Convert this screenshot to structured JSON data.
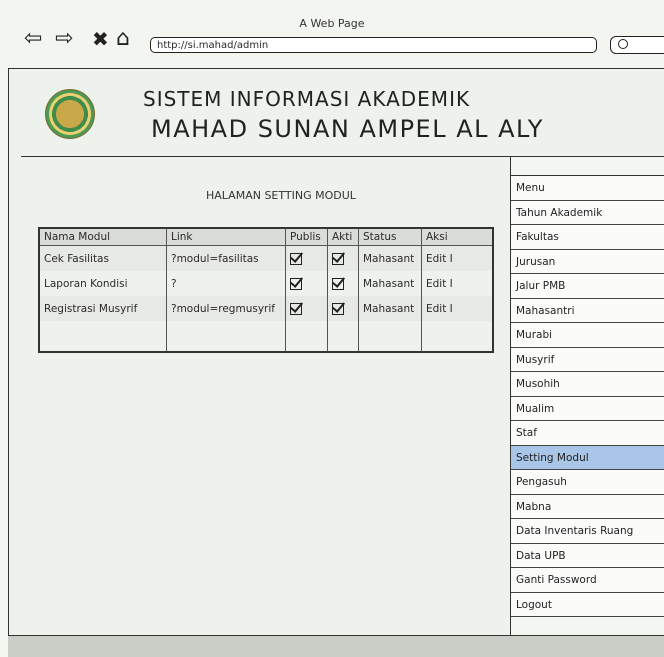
{
  "browser": {
    "window_title": "A Web Page",
    "url": "http://si.mahad/admin"
  },
  "header": {
    "title_line1": "SISTEM INFORMASI AKADEMIK",
    "title_line2": "MAHAD SUNAN AMPEL AL ALY"
  },
  "content": {
    "title": "HALAMAN SETTING MODUL",
    "columns": [
      "Nama Modul",
      "Link",
      "Publis",
      "Akti",
      "Status",
      "Aksi"
    ],
    "rows": [
      {
        "name": "Cek Fasilitas",
        "link": "?modul=fasilitas",
        "status": "Mahasant",
        "action": "Edit I"
      },
      {
        "name": "Laporan Kondisi",
        "link": "?",
        "status": "Mahasant",
        "action": "Edit I"
      },
      {
        "name": "Registrasi Musyrif",
        "link": "?modul=regmusyrif",
        "status": "Mahasant",
        "action": "Edit I"
      }
    ]
  },
  "sidebar": {
    "items": [
      {
        "label": "Menu"
      },
      {
        "label": "Tahun Akademik"
      },
      {
        "label": "Fakultas"
      },
      {
        "label": "Jurusan"
      },
      {
        "label": "Jalur PMB"
      },
      {
        "label": "Mahasantri"
      },
      {
        "label": "Murabi"
      },
      {
        "label": "Musyrif"
      },
      {
        "label": "Musohih"
      },
      {
        "label": "Mualim"
      },
      {
        "label": "Staf"
      },
      {
        "label": "Setting Modul"
      },
      {
        "label": "Pengasuh"
      },
      {
        "label": "Mabna"
      },
      {
        "label": "Data Inventaris Ruang"
      },
      {
        "label": "Data UPB"
      },
      {
        "label": "Ganti Password"
      },
      {
        "label": "Logout"
      }
    ],
    "active": "Setting Modul"
  }
}
